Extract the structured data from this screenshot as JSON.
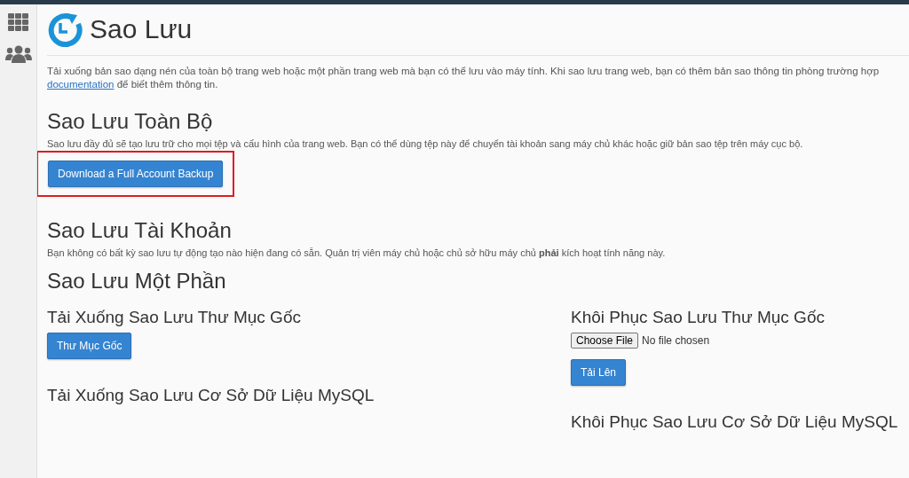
{
  "page_title": "Sao Lưu",
  "intro": {
    "text": "Tải xuống bản sao dạng nén của toàn bộ trang web hoặc một phần trang web mà bạn có thể lưu vào máy tính. Khi sao lưu trang web, bạn có thêm bản sao thông tin phòng trường hợp",
    "link": "documentation",
    "after": " để biết thêm thông tin."
  },
  "full_backup": {
    "heading": "Sao Lưu Toàn Bộ",
    "description": "Sao lưu đầy đủ sẽ tạo lưu trữ cho mọi tệp và cấu hình của trang web. Bạn có thể dùng tệp này để chuyển tài khoản sang máy chủ khác hoặc giữ bản sao tệp trên máy cục bộ.",
    "button": "Download a Full Account Backup",
    "highlighted": true
  },
  "account_backups": {
    "heading": "Sao Lưu Tài Khoản",
    "description": "Bạn không có bất kỳ sao lưu tự động tạo nào hiện đang có sẵn. Quản trị viên máy chủ hoặc chủ sở hữu máy chủ **phải** kích hoạt tính năng này."
  },
  "partial_backups": {
    "heading": "Sao Lưu Một Phần",
    "left": [
      {
        "kind": "download",
        "heading": "Tải Xuống Sao Lưu Thư Mục Gốc",
        "button": "Thư Mục Gốc"
      },
      {
        "kind": "download",
        "heading": "Tải Xuống Sao Lưu Cơ Sở Dữ Liệu MySQL"
      }
    ],
    "right": [
      {
        "kind": "restore",
        "heading": "Khôi Phục Sao Lưu Thư Mục Gốc",
        "file_button": "Choose File",
        "file_status": "No file chosen",
        "button": "Tải Lên"
      },
      {
        "kind": "restore",
        "heading": "Khôi Phục Sao Lưu Cơ Sở Dữ Liệu MySQL"
      }
    ]
  }
}
